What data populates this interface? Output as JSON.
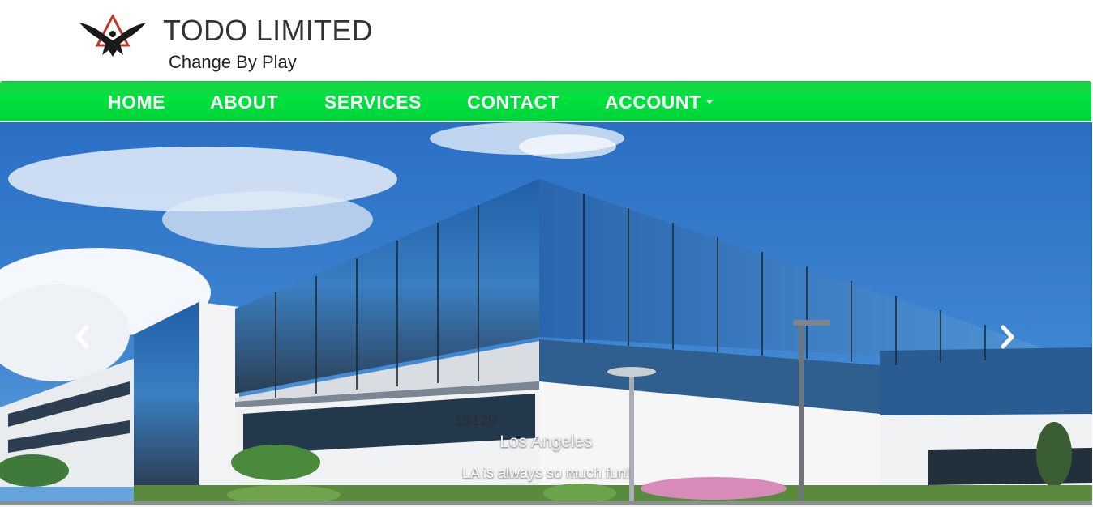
{
  "brand": {
    "title": "TODO LIMITED",
    "tagline": "Change By Play",
    "logo_icon": "eagle-logo-icon"
  },
  "nav": {
    "items": [
      {
        "label": "HOME"
      },
      {
        "label": "ABOUT"
      },
      {
        "label": "SERVICES"
      },
      {
        "label": "CONTACT"
      },
      {
        "label": "ACCOUNT",
        "has_dropdown": true
      }
    ],
    "color": "#00e23f"
  },
  "carousel": {
    "slide": {
      "title": "Los Angeles",
      "text": "LA is always so much fun!",
      "building_number": "15120"
    },
    "prev_icon": "chevron-left-icon",
    "next_icon": "chevron-right-icon"
  }
}
